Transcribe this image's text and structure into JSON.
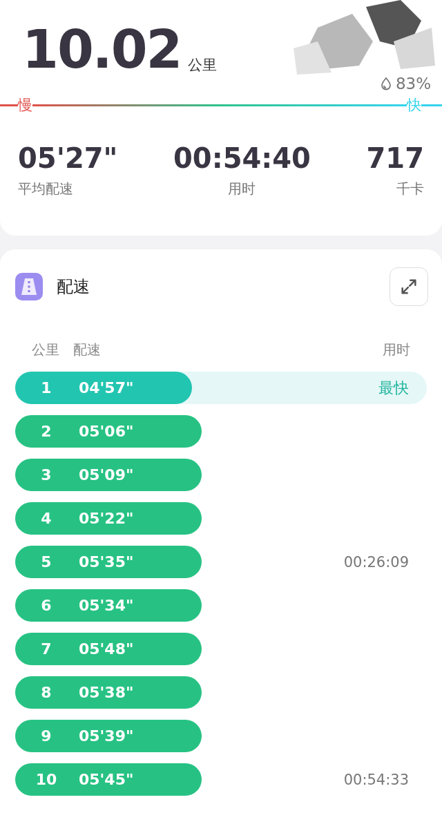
{
  "distance": {
    "value": "10.02",
    "unit": "公里"
  },
  "weather": {
    "humidity": "83%"
  },
  "speed_scale": {
    "slow": "慢",
    "fast": "快"
  },
  "stats": [
    {
      "value": "05'27\"",
      "label": "平均配速"
    },
    {
      "value": "00:54:40",
      "label": "用时"
    },
    {
      "value": "717",
      "label": "千卡"
    }
  ],
  "pace_card": {
    "title": "配速",
    "columns": [
      "公里",
      "配速",
      "用时"
    ],
    "rows": [
      {
        "km": "1",
        "pace": "04'57\"",
        "time": "最快",
        "fastest": true,
        "level": 0.43
      },
      {
        "km": "2",
        "pace": "05'06\"",
        "fastest": false
      },
      {
        "km": "3",
        "pace": "05'09\"",
        "fastest": false
      },
      {
        "km": "4",
        "pace": "05'22\"",
        "fastest": false
      },
      {
        "km": "5",
        "pace": "05'35\"",
        "time": "00:26:09",
        "fastest": false
      },
      {
        "km": "6",
        "pace": "05'34\"",
        "fastest": false
      },
      {
        "km": "7",
        "pace": "05'48\"",
        "fastest": false
      },
      {
        "km": "8",
        "pace": "05'38\"",
        "fastest": false
      },
      {
        "km": "9",
        "pace": "05'39\"",
        "fastest": false
      },
      {
        "km": "10",
        "pace": "05'45\"",
        "time": "00:54:33",
        "fastest": false
      }
    ]
  }
}
